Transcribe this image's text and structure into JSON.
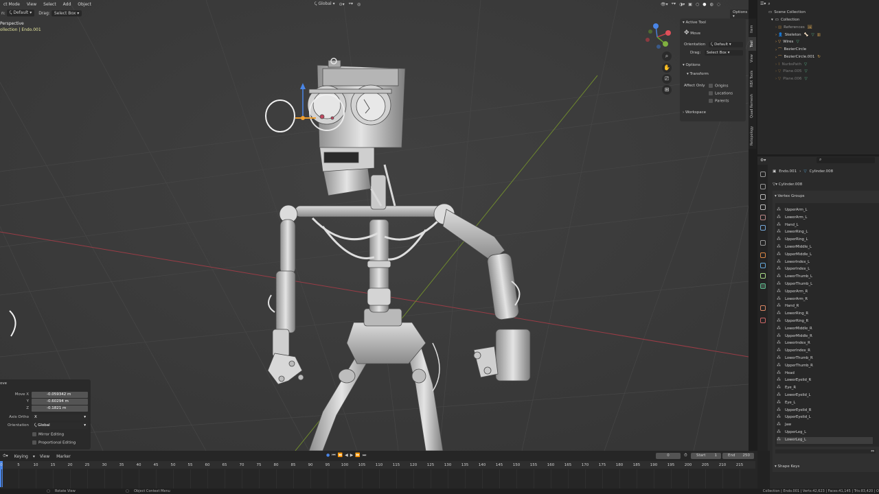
{
  "viewport": {
    "mode": "ct Mode",
    "menu": [
      "View",
      "Select",
      "Add",
      "Object"
    ],
    "orientation_label": "n:",
    "orientation_value": "Default",
    "drag_label": "Drag:",
    "drag_value": "Select Box",
    "transform_space": "Global",
    "options_label": "Options",
    "view_name": "Perspective",
    "collection_path": "ollection | Endo.001"
  },
  "npanel": {
    "active_tool_title": "Active Tool",
    "tool_name": "Move",
    "orientation_label": "Orientation",
    "orientation_value": "Default",
    "drag_label": "Drag:",
    "drag_value": "Select Box",
    "options_title": "Options",
    "transform_title": "Transform",
    "affect_only": "Affect Only",
    "affect_items": [
      "Origins",
      "Locations",
      "Parents"
    ],
    "workspace_title": "Workspace",
    "tabs": [
      "Item",
      "Tool",
      "View",
      "RBX Tools",
      "Quad Remesh",
      "Retopology"
    ]
  },
  "redo_panel": {
    "title": "ove",
    "move_x_label": "Move X",
    "move_x": "-0.059342 m",
    "y_label": "Y",
    "y": "-0.60294 m",
    "z_label": "Z",
    "z": "-0.1821 m",
    "axis_ortho_label": "Axis Ortho",
    "axis_ortho": "X",
    "orientation_label": "Orientation",
    "orientation": "Global",
    "mirror_editing": "Mirror Editing",
    "proportional_editing": "Proportional Editing"
  },
  "outliner": {
    "root": "Scene Collection",
    "collection": "Collection",
    "items": [
      {
        "name": "References",
        "dim": true,
        "color": "#9a9a9a"
      },
      {
        "name": "Skeleton",
        "dim": false,
        "color": "#d8d8d8"
      },
      {
        "name": "Wires",
        "dim": false,
        "color": "#d8d8d8"
      },
      {
        "name": "BezierCircle",
        "dim": false,
        "color": "#d8d8d8"
      },
      {
        "name": "BezierCircle.001",
        "dim": false,
        "color": "#d8d8d8"
      },
      {
        "name": "NurbsPath",
        "dim": true,
        "color": "#7a7a7a"
      },
      {
        "name": "Plane.005",
        "dim": true,
        "color": "#7a7a7a"
      },
      {
        "name": "Plane.006",
        "dim": true,
        "color": "#7a7a7a"
      }
    ]
  },
  "properties": {
    "breadcrumb_object": "Endo.001",
    "breadcrumb_mesh": "Cylinder.008",
    "mesh_name": "Cylinder.008",
    "vertex_groups_title": "Vertex Groups",
    "vertex_groups": [
      "UpperArm_L",
      "LowerArm_L",
      "Hand_L",
      "LowerRing_L",
      "UpperRing_L",
      "LowerMiddle_L",
      "UpperMiddle_L",
      "LowerIndex_L",
      "UpperIndex_L",
      "LowerThumb_L",
      "UpperThumb_L",
      "UpperArm_R",
      "LowerArm_R",
      "Hand_R",
      "LowerRing_R",
      "UpperRing_R",
      "LowerMiddle_R",
      "UpperMiddle_R",
      "LowerIndex_R",
      "UpperIndex_R",
      "LowerThumb_R",
      "UpperThumb_R",
      "Head",
      "LowerEyelid_R",
      "Eye_R",
      "LowerEyelid_L",
      "Eye_L",
      "UpperEyelid_R",
      "UpperEyelid_L",
      "Jaw",
      "UpperLeg_L",
      "LowerLeg_L"
    ],
    "selected_group": "LowerLeg_L",
    "shape_keys_title": "Shape Keys"
  },
  "timeline": {
    "menu": [
      "Keying",
      "View",
      "Marker"
    ],
    "current_frame": "0",
    "start_label": "Start",
    "start": "1",
    "end_label": "End",
    "end": "250",
    "ticks": [
      "0",
      "5",
      "10",
      "15",
      "20",
      "25",
      "30",
      "35",
      "40",
      "45",
      "50",
      "55",
      "60",
      "65",
      "70",
      "75",
      "80",
      "85",
      "90",
      "95",
      "100",
      "105",
      "110",
      "115",
      "120",
      "125",
      "130",
      "135",
      "140",
      "145",
      "150",
      "155",
      "160",
      "165",
      "170",
      "175",
      "180",
      "185",
      "190",
      "195",
      "200",
      "205",
      "210",
      "215"
    ]
  },
  "statusbar": {
    "left_hint": "Rotate View",
    "middle_hint": "Object Context Menu",
    "stats": "Collection | Endo.001 | Verts:42,623 | Faces:41,145 | Tris:83,420 | O"
  },
  "colors": {
    "viewport_bg": "#3d3d3d",
    "x_axis": "#9b3c46",
    "y_axis": "#6f8a2e",
    "active_orange": "#f0a030"
  }
}
